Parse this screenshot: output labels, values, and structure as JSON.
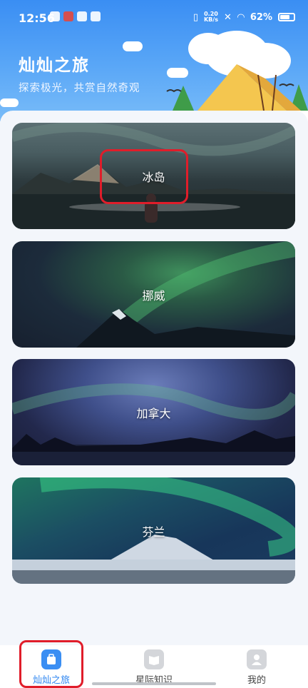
{
  "status_bar": {
    "time": "12:56",
    "network_speed_value": "0.20",
    "network_speed_unit": "KB/s",
    "battery": "62%"
  },
  "header": {
    "title": "灿灿之旅",
    "subtitle": "探索极光，共赏自然奇观"
  },
  "destinations": [
    {
      "label": "冰岛"
    },
    {
      "label": "挪威"
    },
    {
      "label": "加拿大"
    },
    {
      "label": "芬兰"
    }
  ],
  "bottom_nav": {
    "items": [
      {
        "label": "灿灿之旅",
        "icon": "suitcase-icon",
        "active": true
      },
      {
        "label": "星际知识",
        "icon": "book-icon",
        "active": false
      },
      {
        "label": "我的",
        "icon": "profile-icon",
        "active": false
      }
    ]
  },
  "colors": {
    "accent": "#2f86f0",
    "header_top": "#3a8ef3",
    "highlight_box": "#e01d2a"
  }
}
